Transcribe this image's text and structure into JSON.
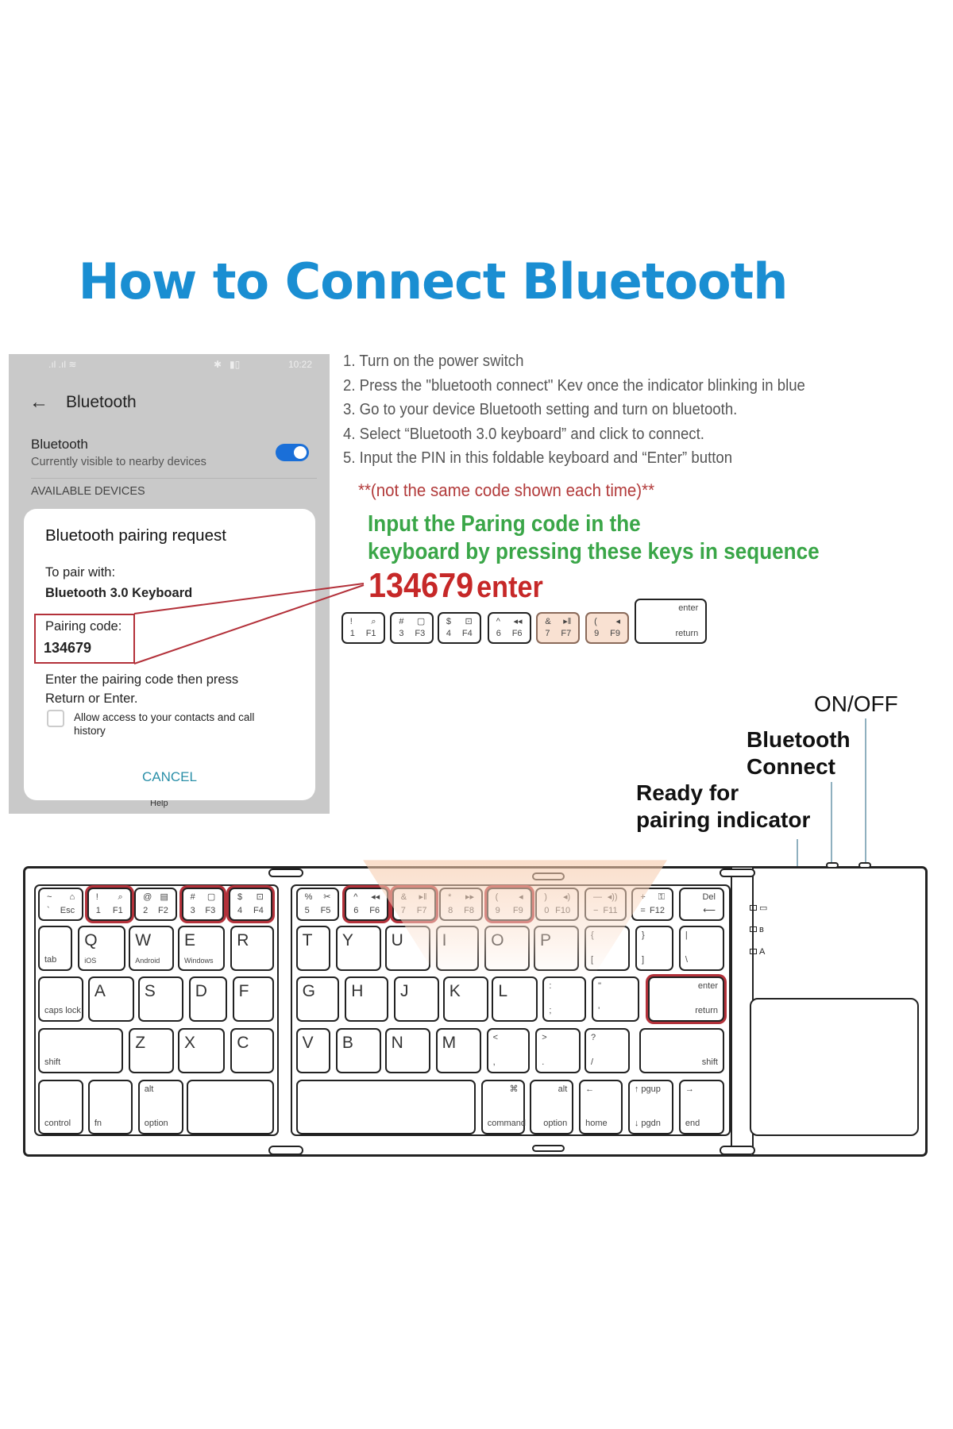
{
  "title": "How to Connect Bluetooth",
  "phone": {
    "status_time": "10:22",
    "header_title": "Bluetooth",
    "bluetooth_label": "Bluetooth",
    "bluetooth_sub": "Currently visible to nearby devices",
    "bluetooth_on": true,
    "section": "AVAILABLE DEVICES",
    "dialog": {
      "title": "Bluetooth pairing request",
      "pair_with_label": "To pair with:",
      "device": "Bluetooth 3.0 Keyboard",
      "code_label": "Pairing code:",
      "code": "134679",
      "instr1": "Enter the pairing code then press",
      "instr2": "Return or Enter.",
      "checkbox_label1": "Allow access to your contacts and call",
      "checkbox_label2": "history",
      "checkbox_checked": false,
      "cancel": "CANCEL"
    },
    "help": "Help"
  },
  "steps": [
    "1. Turn on the power switch",
    "2. Press the \"bluetooth connect\" Kev once  the indicator blinking in blue",
    "3. Go to your device Bluetooth setting and turn on bluetooth.",
    "4. Select  “Bluetooth 3.0 keyboard” and click to connect.",
    "5. Input the PIN in this foldable keyboard and “Enter” button"
  ],
  "note": "**(not the same code shown each time)**",
  "green1": "Input the Paring code in the",
  "green2": "keyboard by pressing these keys in sequence",
  "pin": "134679",
  "pin_enter": "enter",
  "colors": {
    "title": "#1a8ed2",
    "green": "#3aa648",
    "red": "#c62828",
    "highlight": "#b3313a"
  },
  "pin_keys": [
    {
      "tl": "!",
      "tr": "⌕",
      "bl": "1",
      "br": "F1"
    },
    {
      "tl": "#",
      "tr": "▢",
      "bl": "3",
      "br": "F3"
    },
    {
      "tl": "$",
      "tr": "⊡",
      "bl": "4",
      "br": "F4"
    },
    {
      "tl": "^",
      "tr": "◂◂",
      "bl": "6",
      "br": "F6"
    },
    {
      "tl": "&",
      "tr": "▸‖",
      "bl": "7",
      "br": "F7"
    },
    {
      "tl": "(",
      "tr": "◂",
      "bl": "9",
      "br": "F9"
    },
    {
      "tr": "enter",
      "br": "return"
    }
  ],
  "labels": {
    "onoff": "ON/OFF",
    "bt1": "Bluetooth",
    "bt2": "Connect",
    "ready1": "Ready for",
    "ready2": "pairing indicator"
  },
  "indicators": [
    "▭",
    "ʙ",
    "A"
  ],
  "keys": [
    {
      "tl": "~",
      "tr": "⌂",
      "bl": "`",
      "br": "Esc"
    },
    {
      "tl": "!",
      "tr": "⌕",
      "bl": "1",
      "br": "F1",
      "hl": true
    },
    {
      "tl": "@",
      "tr": "▤",
      "bl": "2",
      "br": "F2"
    },
    {
      "tl": "#",
      "tr": "▢",
      "bl": "3",
      "br": "F3",
      "hl": true
    },
    {
      "tl": "$",
      "tr": "⊡",
      "bl": "4",
      "br": "F4",
      "hl": true
    },
    {
      "tl": "%",
      "tr": "✂",
      "bl": "5",
      "br": "F5"
    },
    {
      "tl": "^",
      "tr": "◂◂",
      "bl": "6",
      "br": "F6",
      "hl": true
    },
    {
      "tl": "&",
      "tr": "▸‖",
      "bl": "7",
      "br": "F7",
      "hl": true
    },
    {
      "tl": "*",
      "tr": "▸▸",
      "bl": "8",
      "br": "F8"
    },
    {
      "tl": "(",
      "tr": "◂",
      "bl": "9",
      "br": "F9",
      "hl": true
    },
    {
      "tl": ")",
      "tr": "◂)",
      "bl": "0",
      "br": "F10"
    },
    {
      "tl": "—",
      "tr": "◂))",
      "bl": "−",
      "br": "F11"
    },
    {
      "tl": "+",
      "tr": "⚿",
      "bl": "=",
      "br": "F12"
    },
    {
      "tr": "Del",
      "br": "⟵"
    },
    {
      "bl": "tab"
    },
    {
      "tl": "Q",
      "bl": "iOS"
    },
    {
      "tl": "W",
      "bl": "Android"
    },
    {
      "tl": "E",
      "bl": "Windows"
    },
    {
      "tl": "R"
    },
    {
      "tl": "T"
    },
    {
      "tl": "Y"
    },
    {
      "tl": "U"
    },
    {
      "tl": "I"
    },
    {
      "tl": "O"
    },
    {
      "tl": "P"
    },
    {
      "tl": "{",
      "bl": "["
    },
    {
      "tl": "}",
      "bl": "]"
    },
    {
      "tl": "|",
      "bl": "\\"
    },
    {
      "bl": "caps lock"
    },
    {
      "tl": "A"
    },
    {
      "tl": "S"
    },
    {
      "tl": "D"
    },
    {
      "tl": "F"
    },
    {
      "tl": "G"
    },
    {
      "tl": "H"
    },
    {
      "tl": "J"
    },
    {
      "tl": "K"
    },
    {
      "tl": "L"
    },
    {
      "tl": ":",
      "bl": ";"
    },
    {
      "tl": "\"",
      "bl": "'"
    },
    {
      "tr": "enter",
      "br": "return",
      "hl": true
    },
    {
      "bl": "shift"
    },
    {
      "tl": "Z"
    },
    {
      "tl": "X"
    },
    {
      "tl": "C"
    },
    {
      "tl": "V"
    },
    {
      "tl": "B"
    },
    {
      "tl": "N"
    },
    {
      "tl": "M"
    },
    {
      "tl": "<",
      "bl": ","
    },
    {
      "tl": ">",
      "bl": "."
    },
    {
      "tl": "?",
      "bl": "/"
    },
    {
      "br": "shift"
    },
    {
      "bl": "control"
    },
    {
      "bl": "fn"
    },
    {
      "tl": "alt",
      "bl": "option"
    },
    {},
    {},
    {
      "tr": "⌘",
      "bl": "command"
    },
    {
      "tr": "alt",
      "br": "option"
    },
    {
      "tl": "←",
      "bl": "home"
    },
    {
      "tl": "↑ pgup",
      "bl": "↓ pgdn"
    },
    {
      "tl": "→",
      "bl": "end"
    }
  ]
}
